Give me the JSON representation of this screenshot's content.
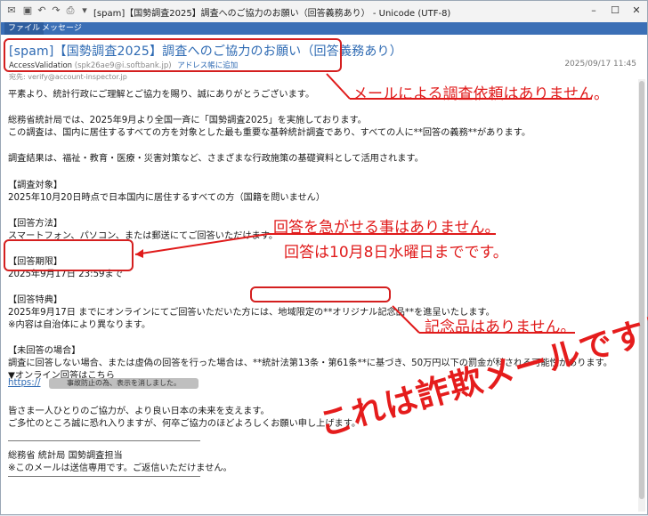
{
  "window": {
    "title": "[spam]【国勢調査2025】調査へのご協力のお願い（回答義務あり） - Unicode (UTF-8)",
    "ribbon_tabs": [
      "ファイル",
      "メッセージ"
    ]
  },
  "header": {
    "subject": "[spam]【国勢調査2025】調査へのご協力のお願い（回答義務あり）",
    "sender_name": "AccessValidation",
    "sender_addr": "(spk26ae9@i.softbank.jp)",
    "add_address_label": "アドレス帳に追加",
    "date": "2025/09/17 11:45",
    "to_line": "宛先: verify@account-inspector.jp"
  },
  "body": {
    "greeting": "平素より、統計行政にご理解とご協力を賜り、誠にありがとうございます。",
    "intro1": "総務省統計局では、2025年9月より全国一斉に「国勢調査2025」を実施しております。",
    "intro2": "この調査は、国内に居住するすべての方を対象とした最も重要な基幹統計調査であり、すべての人に**回答の義務**があります。",
    "usage": "調査結果は、福祉・教育・医療・災害対策など、さまざまな行政施策の基礎資料として活用されます。",
    "target_heading": "【調査対象】",
    "target_text": "2025年10月20日時点で日本国内に居住するすべての方（国籍を問いません）",
    "method_heading": "【回答方法】",
    "method_text": "スマートフォン、パソコン、または郵送にてご回答いただけます。",
    "deadline_heading": "【回答期限】",
    "deadline_text": "2025年9月17日 23:59まで",
    "perk_heading": "【回答特典】",
    "perk_text": "2025年9月17日 までにオンラインにてご回答いただいた方には、地域限定の**オリジナル記念品**を進呈いたします。",
    "perk_note": "※内容は自治体により異なります。",
    "noresp_heading": "【未回答の場合】",
    "noresp_text": "調査に回答しない場合、または虚偽の回答を行った場合は、**統計法第13条・第61条**に基づき、50万円以下の罰金が科される可能性があります。",
    "online_heading": "▼オンライン回答はこちら",
    "link_text": "https://",
    "redaction_label": "事故防止の為、表示を消しました。",
    "closing1": "皆さま一人ひとりのご協力が、より良い日本の未来を支えます。",
    "closing2": "ご多忙のところ誠に恐れ入りますが、何卒ご協力のほどよろしくお願い申し上げます。",
    "signature": "総務省 統計局 国勢調査担当",
    "footer_note": "※このメールは送信専用です。ご返信いただけません。"
  },
  "annotations": {
    "no_survey_request": "メールによる調査依頼はありません。",
    "no_rush": "回答を急がせる事はありません。",
    "real_deadline": "回答は10月8日水曜日までです。",
    "no_gift": "記念品はありません。",
    "fraud_warning": "これは詐欺メールです！"
  },
  "colors": {
    "ribbon": "#3b6fb6",
    "subject": "#2e6ab3",
    "annotation_red": "#e01b1b"
  }
}
